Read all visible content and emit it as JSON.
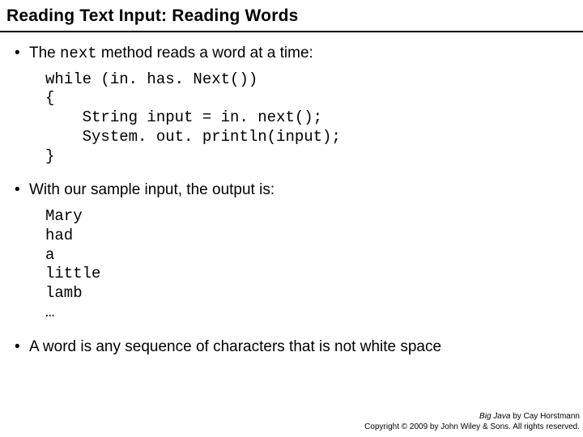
{
  "title": "Reading Text Input: Reading Words",
  "bullets": {
    "b1_pre": "The ",
    "b1_code": "next",
    "b1_post": " method reads a word at a time:",
    "code1": "while (in. has. Next())\n{\n    String input = in. next();\n    System. out. println(input);\n}",
    "b2": "With our sample input, the output is:",
    "code2": "Mary\nhad\na\nlittle\nlamb\n…",
    "b3": "A word is any sequence of characters that is not white space"
  },
  "footer": {
    "line1_title": "Big Java",
    "line1_rest": " by Cay Horstmann",
    "line2": "Copyright © 2009 by John Wiley & Sons.  All rights reserved."
  }
}
